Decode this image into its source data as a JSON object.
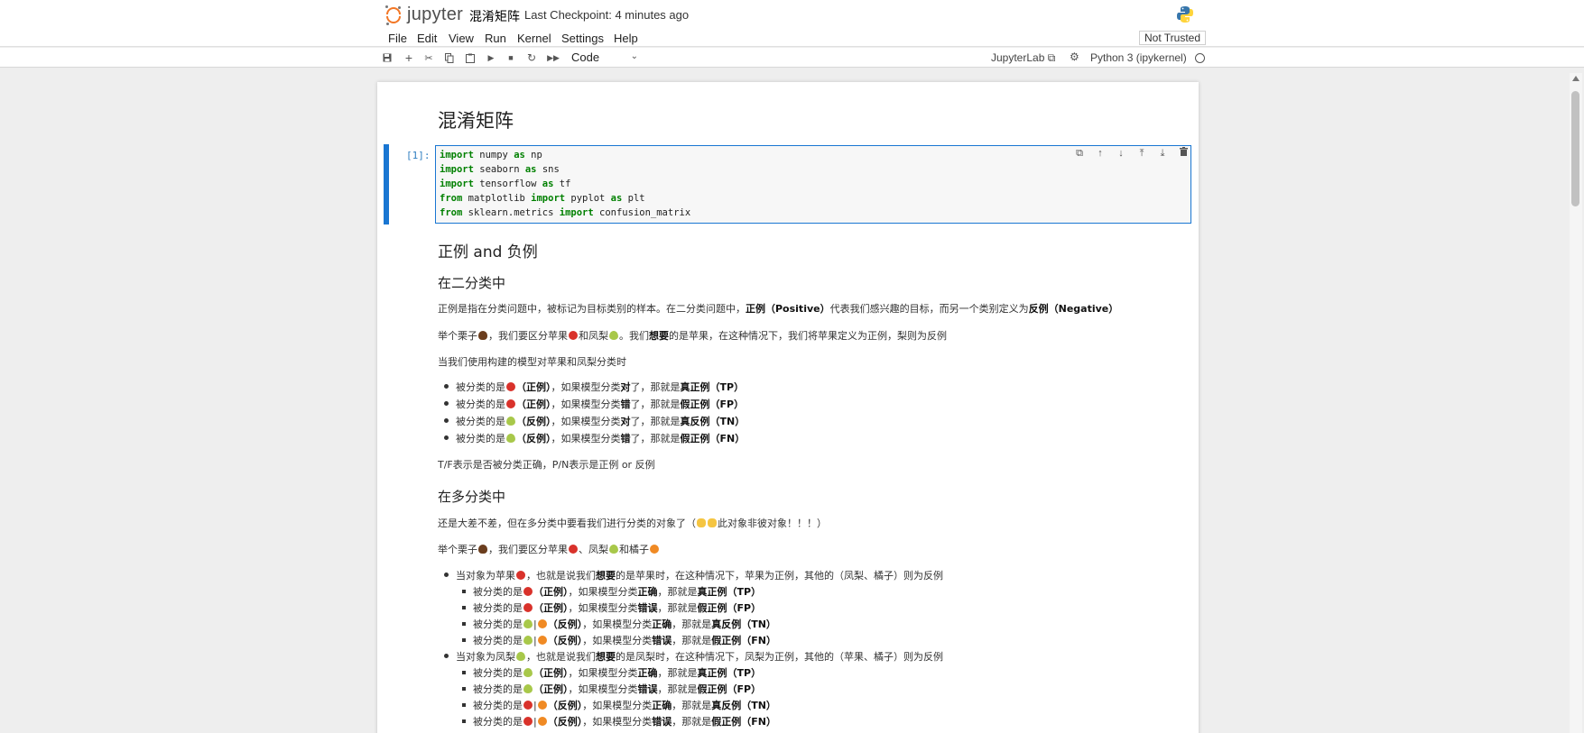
{
  "header": {
    "logo_text": "jupyter",
    "notebook_title": "混淆矩阵",
    "checkpoint": "Last Checkpoint: 4 minutes ago"
  },
  "menu": {
    "items": [
      "File",
      "Edit",
      "View",
      "Run",
      "Kernel",
      "Settings",
      "Help"
    ],
    "trust_status": "Not Trusted"
  },
  "toolbar": {
    "cell_type": "Code",
    "jupyterlab_label": "JupyterLab ⧉",
    "kernel_name": "Python 3 (ipykernel)"
  },
  "cells": {
    "title": "混淆矩阵",
    "code_prompt": "[1]:",
    "code": [
      {
        "kw1": "import",
        "t1": " numpy ",
        "kw2": "as",
        "t2": " np"
      },
      {
        "kw1": "import",
        "t1": " seaborn ",
        "kw2": "as",
        "t2": " sns"
      },
      {
        "kw1": "import",
        "t1": " tensorflow ",
        "kw2": "as",
        "t2": " tf"
      },
      {
        "kw1": "from",
        "t1": " matplotlib ",
        "kw2": "import",
        "t2": " pyplot ",
        "kw3": "as",
        "t3": " plt"
      },
      {
        "kw1": "from",
        "t1": " sklearn.metrics ",
        "kw2": "import",
        "t2": " confusion_matrix"
      }
    ],
    "h2": "正例 and 负例",
    "h3_binary": "在二分类中",
    "p1_a": "正例是指在分类问题中，被标记为目标类别的样本。在二分类问题中，",
    "p1_b": "正例（Positive）",
    "p1_c": "代表我们感兴趣的目标，而另一个类别定义为",
    "p1_d": "反例（Negative）",
    "p2_a": "举个栗子",
    "p2_b": "，我们要区分苹果",
    "p2_c": "和凤梨",
    "p2_d": "。我们",
    "p2_e": "想要",
    "p2_f": "的是苹果，在这种情况下，我们将苹果定义为正例，梨则为反例",
    "p3": "当我们使用构建的模型对苹果和凤梨分类时",
    "binary_list": [
      {
        "pre": "被分类的是",
        "fruit": "apple",
        "cls": "（正例）",
        "mid": "，如果模型分类",
        "res": "对",
        "mid2": "了，那就是",
        "tag": "真正例（TP）"
      },
      {
        "pre": "被分类的是",
        "fruit": "apple",
        "cls": "（正例）",
        "mid": "，如果模型分类",
        "res": "错",
        "mid2": "了，那就是",
        "tag": "假正例（FP）"
      },
      {
        "pre": "被分类的是",
        "fruit": "pear",
        "cls": "（反例）",
        "mid": "，如果模型分类",
        "res": "对",
        "mid2": "了，那就是",
        "tag": "真反例（TN）"
      },
      {
        "pre": "被分类的是",
        "fruit": "pear",
        "cls": "（反例）",
        "mid": "，如果模型分类",
        "res": "错",
        "mid2": "了，那就是",
        "tag": "假正例（FN）"
      }
    ],
    "p4": "T/F表示是否被分类正确，P/N表示是正例 or 反例",
    "h3_multi": "在多分类中",
    "p5_a": "还是大差不差，但在多分类中要看我们进行分类的对象了（",
    "p5_b": "此对象非彼对象！！！）",
    "p6_a": "举个栗子",
    "p6_b": "，我们要区分苹果",
    "p6_c": "、凤梨",
    "p6_d": "和橘子",
    "multi_apple_head_a": "当对象为苹果",
    "multi_apple_head_b": "，也就是说我们",
    "multi_apple_head_c": "想要",
    "multi_apple_head_d": "的是苹果时，在这种情况下，苹果为正例，其他的（凤梨、橘子）则为反例",
    "multi_pear_head_a": "当对象为凤梨",
    "multi_pear_head_b": "，也就是说我们",
    "multi_pear_head_c": "想要",
    "multi_pear_head_d": "的是凤梨时，在这种情况下，凤梨为正例，其他的（苹果、橘子）则为反例",
    "multi_apple_list": [
      {
        "pre": "被分类的是",
        "fruits": [
          "apple"
        ],
        "cls": "（正例）",
        "mid": "，如果模型分类",
        "res": "正确",
        "mid2": "，那就是",
        "tag": "真正例（TP）"
      },
      {
        "pre": "被分类的是",
        "fruits": [
          "apple"
        ],
        "cls": "（正例）",
        "mid": "，如果模型分类",
        "res": "错误",
        "mid2": "，那就是",
        "tag": "假正例（FP）"
      },
      {
        "pre": "被分类的是",
        "fruits": [
          "pear",
          "orange"
        ],
        "cls": "（反例）",
        "mid": "，如果模型分类",
        "res": "正确",
        "mid2": "，那就是",
        "tag": "真反例（TN）"
      },
      {
        "pre": "被分类的是",
        "fruits": [
          "pear",
          "orange"
        ],
        "cls": "（反例）",
        "mid": "，如果模型分类",
        "res": "错误",
        "mid2": "，那就是",
        "tag": "假正例（FN）"
      }
    ],
    "multi_pear_list": [
      {
        "pre": "被分类的是",
        "fruits": [
          "pear"
        ],
        "cls": "（正例）",
        "mid": "，如果模型分类",
        "res": "正确",
        "mid2": "，那就是",
        "tag": "真正例（TP）"
      },
      {
        "pre": "被分类的是",
        "fruits": [
          "pear"
        ],
        "cls": "（正例）",
        "mid": "，如果模型分类",
        "res": "错误",
        "mid2": "，那就是",
        "tag": "假正例（FP）"
      },
      {
        "pre": "被分类的是",
        "fruits": [
          "apple",
          "orange"
        ],
        "cls": "（反例）",
        "mid": "，如果模型分类",
        "res": "正确",
        "mid2": "，那就是",
        "tag": "真反例（TN）"
      },
      {
        "pre": "被分类的是",
        "fruits": [
          "apple",
          "orange"
        ],
        "cls": "（反例）",
        "mid": "，如果模型分类",
        "res": "错误",
        "mid2": "，那就是",
        "tag": "假正例（FN）"
      }
    ]
  },
  "colors": {
    "accent": "#1976d2",
    "jupyter_orange": "#f37726",
    "keyword": "#008000"
  }
}
